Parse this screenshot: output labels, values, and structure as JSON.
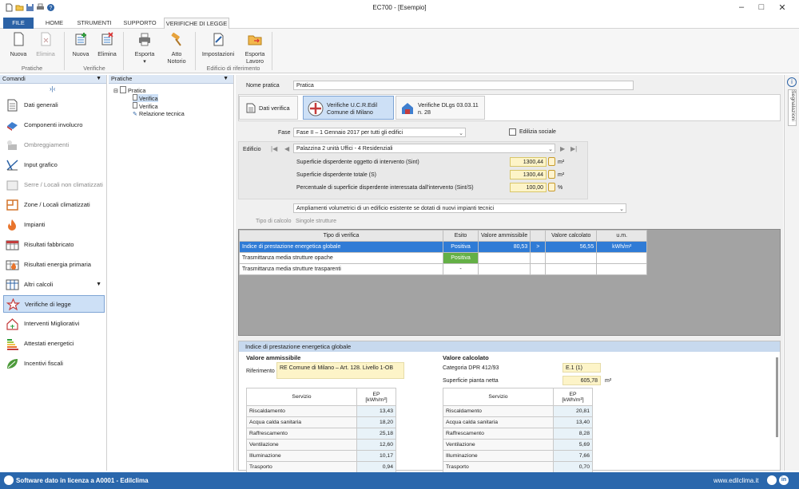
{
  "window": {
    "title": "EC700 - [Esempio]"
  },
  "tabs": [
    "FILE",
    "HOME",
    "STRUMENTI",
    "SUPPORTO",
    "VERIFICHE DI LEGGE"
  ],
  "ribbon": {
    "pratiche": {
      "nuova": "Nuova",
      "elimina": "Elimina",
      "label": "Pratiche"
    },
    "verifiche": {
      "nuova": "Nuova",
      "elimina": "Elimina",
      "label": "Verifiche"
    },
    "esporta": "Esporta",
    "atto": "Atto Notorio",
    "impostazioni": "Impostazioni",
    "esporta_lavoro": "Esporta Lavoro",
    "edificio_label": "Edificio di riferimento"
  },
  "panels": {
    "comandi": "Comandi",
    "pratiche": "Pratiche"
  },
  "nav": [
    "Dati generali",
    "Componenti involucro",
    "Ombreggiamenti",
    "Input grafico",
    "Serre / Locali non climatizzati",
    "Zone / Locali climatizzati",
    "Impianti",
    "Risultati fabbricato",
    "Risultati energia primaria",
    "Altri calcoli",
    "Verifiche di legge",
    "Interventi Migliorativi",
    "Attestati energetici",
    "Incentivi fiscali"
  ],
  "tree": {
    "root": "Pratica",
    "c1": "Verifica",
    "c2": "Verifica",
    "c3": "Relazione tecnica"
  },
  "form": {
    "nome_label": "Nome pratica",
    "nome_value": "Pratica",
    "tab_dati": "Dati verifica",
    "tab_ucr_1": "Verifiche U.C.R.Edil",
    "tab_ucr_2": "Comune di Milano",
    "tab_dlgs_1": "Verifiche DLgs 03.03.11",
    "tab_dlgs_2": "n. 28",
    "fase_label": "Fase",
    "fase_value": "Fase II – 1 Gennaio 2017 per tutti gli edifici",
    "edilizia": "Edilizia sociale",
    "edificio_label": "Edificio",
    "edificio_value": "Palazzina 2 unità Uffici - 4 Residenziali",
    "sint_label": "Superficie disperdente oggetto di intervento (Sint)",
    "sint_value": "1300,44",
    "s_label": "Superficie disperdente totale (S)",
    "s_value": "1300,44",
    "perc_label": "Percentuale di superficie disperdente interessata dall'intervento (Sint/S)",
    "perc_value": "100,00",
    "unit_m2": "m²",
    "unit_pct": "%",
    "ampliamenti": "Ampliamenti volumetrici di un edificio esistente se dotati di nuovi impianti tecnici",
    "tipo_calcolo_label": "Tipo di calcolo",
    "tipo_calcolo_value": "Singole strutture"
  },
  "grid": {
    "headers": [
      "Tipo di verifica",
      "Esito",
      "Valore ammissibile",
      "",
      "Valore calcolato",
      "u.m."
    ],
    "rows": [
      [
        "Indice di prestazione energetica globale",
        "Positiva",
        "80,53",
        ">",
        "56,55",
        "kWh/m²"
      ],
      [
        "Trasmittanza media strutture opache",
        "Positiva",
        "",
        "",
        "",
        ""
      ],
      [
        "Trasmittanza media strutture trasparenti",
        "-",
        "",
        "",
        "",
        ""
      ]
    ]
  },
  "detail": {
    "title": "Indice di prestazione energetica globale",
    "amm_title": "Valore ammissibile",
    "rif_label": "Riferimento",
    "rif_value": "RE Comune di Milano – Art.  128. Livello 1-OB",
    "calc_title": "Valore calcolato",
    "cat_label": "Categoria DPR 412/93",
    "cat_value": "E.1 (1)",
    "sup_label": "Superficie pianta netta",
    "sup_value": "605,78",
    "sup_unit": "m²",
    "col_servizio": "Servizio",
    "col_ep_1": "EP",
    "col_ep_2": "[kWh/m²]",
    "amm_rows": [
      [
        "Riscaldamento",
        "13,43"
      ],
      [
        "Acqua calda sanitaria",
        "18,20"
      ],
      [
        "Raffrescamento",
        "25,18"
      ],
      [
        "Ventilazione",
        "12,60"
      ],
      [
        "Illuminazione",
        "10,17"
      ],
      [
        "Trasporto",
        "0,94"
      ]
    ],
    "calc_rows": [
      [
        "Riscaldamento",
        "20,81"
      ],
      [
        "Acqua calda sanitaria",
        "13,40"
      ],
      [
        "Raffrescamento",
        "8,28"
      ],
      [
        "Ventilazione",
        "5,69"
      ],
      [
        "Illuminazione",
        "7,66"
      ],
      [
        "Trasporto",
        "0,70"
      ]
    ]
  },
  "rail": "Segnalazioni",
  "status": {
    "left": "Software dato in licenza a A0001 - Edilclima",
    "right": "www.edilclima.it"
  }
}
